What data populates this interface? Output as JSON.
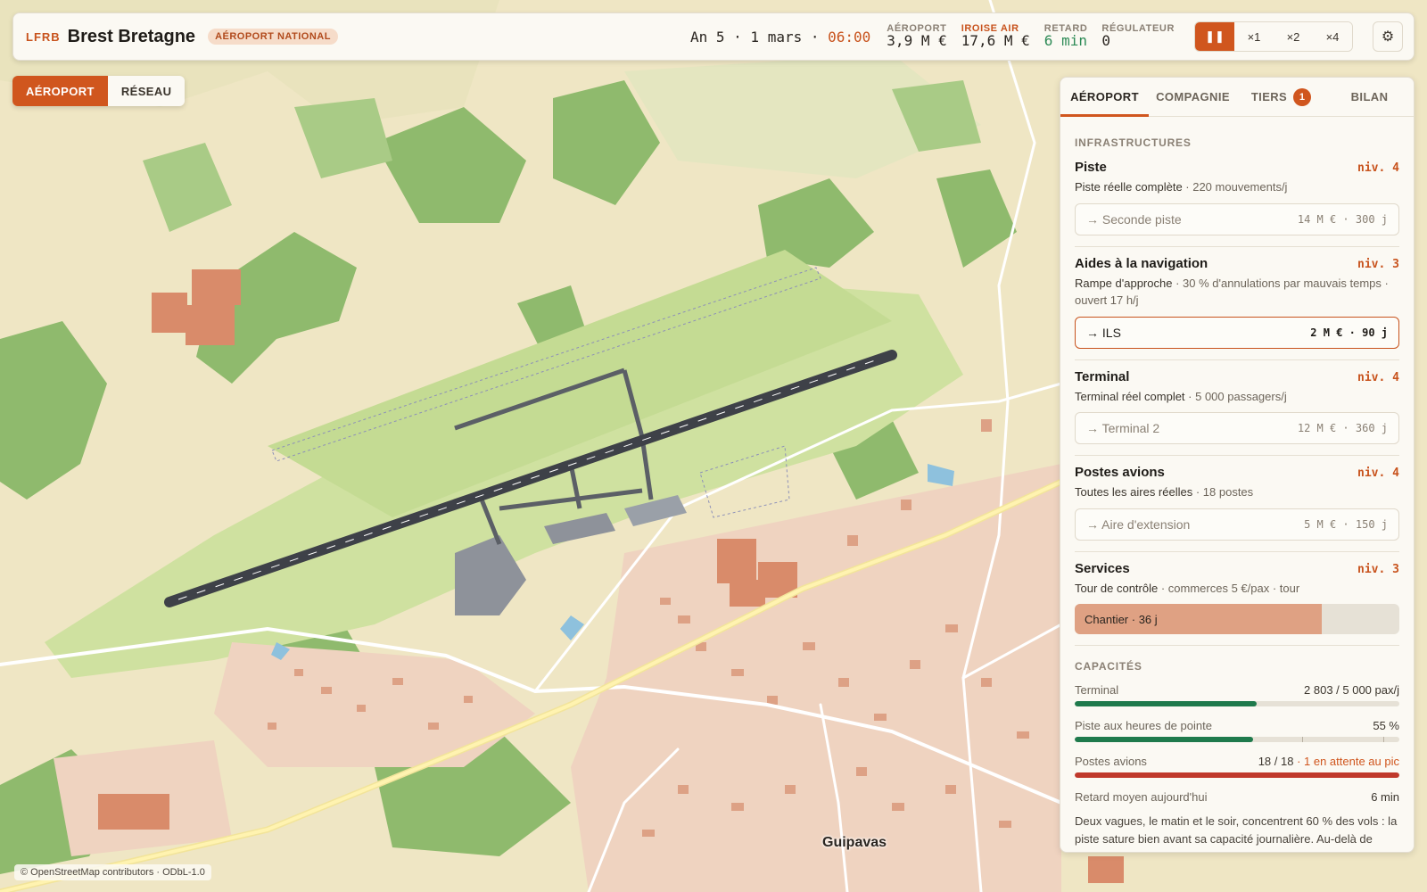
{
  "header": {
    "icao": "LFRB",
    "airport_name": "Brest Bretagne",
    "badge": "AÉROPORT NATIONAL",
    "date": "An 5 · 1 mars · ",
    "time": "06:00",
    "stats": [
      {
        "label": "AÉROPORT",
        "value": "3,9 M €"
      },
      {
        "label": "IROISE AIR",
        "value": "17,6 M €"
      },
      {
        "label": "RETARD",
        "value": "6 min"
      },
      {
        "label": "RÉGULATEUR",
        "value": "0"
      }
    ],
    "speed": {
      "pause_icon": "pause-icon",
      "x1": "×1",
      "x2": "×2",
      "x4": "×4"
    },
    "settings_icon": "gear-icon"
  },
  "map_modes": {
    "airport": "AÉROPORT",
    "network": "RÉSEAU"
  },
  "panel": {
    "tabs": {
      "airport": "AÉROPORT",
      "company": "COMPAGNIE",
      "thirds": "TIERS",
      "thirds_count": "1",
      "summary": "BILAN"
    },
    "infra_title": "INFRASTRUCTURES",
    "infra": [
      {
        "name": "Piste",
        "level": "niv. 4",
        "desc": "Piste réelle complète",
        "desc2": " · 220 mouvements/j",
        "upgrade": "→ Seconde piste",
        "cost": "14 M € · 300 j"
      },
      {
        "name": "Aides à la navigation",
        "level": "niv. 3",
        "desc": "Rampe d'approche",
        "desc2": " · 30 % d'annulations par mauvais temps · ouvert 17 h/j",
        "upgrade": "→ ILS",
        "cost": "2 M € · 90 j"
      },
      {
        "name": "Terminal",
        "level": "niv. 4",
        "desc": "Terminal réel complet",
        "desc2": " · 5 000 passagers/j",
        "upgrade": "→ Terminal 2",
        "cost": "12 M € · 360 j"
      },
      {
        "name": "Postes avions",
        "level": "niv. 4",
        "desc": "Toutes les aires réelles",
        "desc2": " · 18 postes",
        "upgrade": "→ Aire d'extension",
        "cost": "5 M € · 150 j"
      },
      {
        "name": "Services",
        "level": "niv. 3",
        "desc": "Tour de contrôle",
        "desc2": " · commerces 5 €/pax · tour",
        "build": "Chantier · 36 j",
        "build_progress": 0.76
      }
    ],
    "cap_title": "CAPACITÉS",
    "capacities": {
      "terminal": {
        "label": "Terminal",
        "value": "2 803 / 5 000 pax/j",
        "fraction": 0.56,
        "color": "#1f7a4c"
      },
      "runway": {
        "label": "Piste aux heures de pointe",
        "value": "55 %",
        "fraction": 0.55,
        "color": "#1f7a4c"
      },
      "stands": {
        "label": "Postes avions",
        "value": "18 / 18",
        "warn": " · 1 en attente au pic",
        "fraction": 1.0,
        "color": "#c0392b"
      },
      "delay": {
        "label": "Retard moyen aujourd'hui",
        "value": "6 min"
      }
    },
    "note": "Deux vagues, le matin et le soir, concentrent 60 % des vols : la piste sature bien avant sa capacité journalière. Au-delà de"
  },
  "map": {
    "town": "Guipavas",
    "attribution": "© OpenStreetMap contributors · ODbL-1.0"
  },
  "colors": {
    "accent": "#d0561e",
    "good": "#1f7a4c",
    "bad": "#c0392b"
  }
}
